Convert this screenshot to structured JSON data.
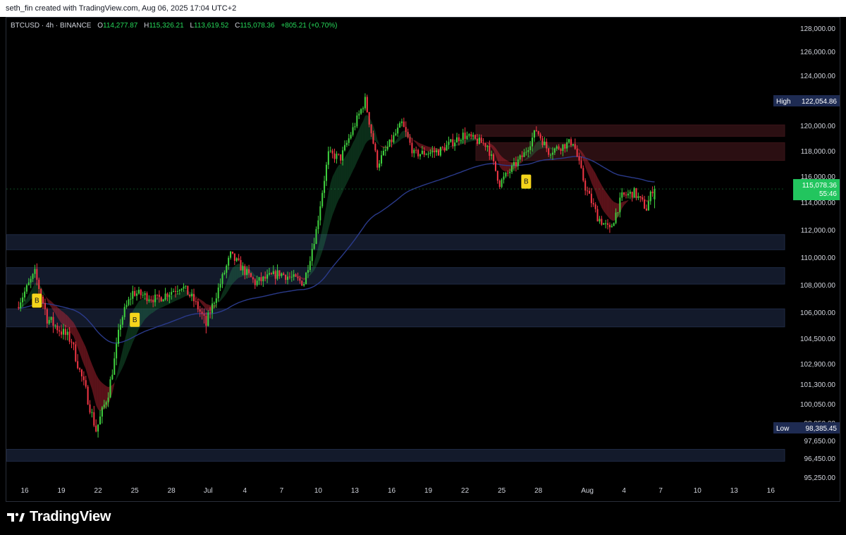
{
  "caption": "seth_fin created with TradingView.com, Aug 06, 2025 17:04 UTC+2",
  "legend": {
    "symbol": "BTCUSD · 4h · BINANCE",
    "open_label": "O",
    "open": "114,277.87",
    "high_label": "H",
    "high": "115,326.21",
    "low_label": "L",
    "low": "113,619.52",
    "close_label": "C",
    "close": "115,078.36",
    "change": "+805.21 (+0.70%)"
  },
  "brand": {
    "name": "TradingView"
  },
  "markers": {
    "buy_label": "B"
  },
  "chart_data": {
    "type": "candlestick",
    "symbol": "BTCUSD",
    "interval": "4h",
    "exchange": "BINANCE",
    "y_ticks": [
      "128,000.00",
      "126,000.00",
      "124,000.00",
      "122,000.00",
      "120,000.00",
      "118,000.00",
      "116,000.00",
      "114,000.00",
      "112,000.00",
      "110,000.00",
      "108,000.00",
      "106,000.00",
      "104,500.00",
      "102,900.00",
      "101,300.00",
      "100,050.00",
      "98,850.00",
      "97,650.00",
      "96,450.00",
      "95,250.00"
    ],
    "x_ticks": [
      "16",
      "19",
      "22",
      "25",
      "28",
      "Jul",
      "4",
      "7",
      "10",
      "13",
      "16",
      "19",
      "22",
      "25",
      "28",
      "Aug",
      "4",
      "7",
      "10",
      "13",
      "16"
    ],
    "high_marker": {
      "label": "High",
      "value": "122,054.86"
    },
    "low_marker": {
      "label": "Low",
      "value": "98,385.45"
    },
    "last_price": {
      "value": "115,078.36",
      "countdown": "55:46"
    },
    "scale": "log-like",
    "keypoints": [
      [
        "2025-06-15",
        105600
      ],
      [
        "2025-06-17",
        108900
      ],
      [
        "2025-06-18",
        105700
      ],
      [
        "2025-06-20",
        104400
      ],
      [
        "2025-06-22",
        98400
      ],
      [
        "2025-06-23",
        100800
      ],
      [
        "2025-06-24",
        105500
      ],
      [
        "2025-06-25",
        107500
      ],
      [
        "2025-06-27",
        107000
      ],
      [
        "2025-06-29",
        108000
      ],
      [
        "2025-06-30",
        106900
      ],
      [
        "2025-07-01",
        105300
      ],
      [
        "2025-07-03",
        110200
      ],
      [
        "2025-07-05",
        108200
      ],
      [
        "2025-07-07",
        108900
      ],
      [
        "2025-07-09",
        108200
      ],
      [
        "2025-07-10",
        112000
      ],
      [
        "2025-07-11",
        117800
      ],
      [
        "2025-07-12",
        117500
      ],
      [
        "2025-07-14",
        122054
      ],
      [
        "2025-07-15",
        117000
      ],
      [
        "2025-07-17",
        120200
      ],
      [
        "2025-07-18",
        117800
      ],
      [
        "2025-07-20",
        118000
      ],
      [
        "2025-07-22",
        119300
      ],
      [
        "2025-07-24",
        118500
      ],
      [
        "2025-07-25",
        115500
      ],
      [
        "2025-07-27",
        117800
      ],
      [
        "2025-07-28",
        119700
      ],
      [
        "2025-07-29",
        118000
      ],
      [
        "2025-07-31",
        118800
      ],
      [
        "2025-08-01",
        115200
      ],
      [
        "2025-08-02",
        113000
      ],
      [
        "2025-08-03",
        112000
      ],
      [
        "2025-08-04",
        114500
      ],
      [
        "2025-08-05",
        114800
      ],
      [
        "2025-08-06",
        113600
      ],
      [
        "2025-08-06T12",
        115078
      ]
    ],
    "buy_signals": [
      "2025-06-17",
      "2025-06-25",
      "2025-07-27"
    ],
    "zones": [
      {
        "kind": "resistance",
        "from": 119200,
        "to": 120100
      },
      {
        "kind": "resistance",
        "from": 117300,
        "to": 118700
      },
      {
        "kind": "support",
        "from": 110600,
        "to": 111700
      },
      {
        "kind": "support",
        "from": 108100,
        "to": 109300
      },
      {
        "kind": "support",
        "from": 105200,
        "to": 106300
      },
      {
        "kind": "support",
        "from": 96300,
        "to": 97100
      }
    ],
    "colors": {
      "up": "#26a69a",
      "up_bright": "#3fd13f",
      "down": "#f23645",
      "ma": "#2a3a8a",
      "support_zone": "#131a2b",
      "resistance_zone": "#2b0f12",
      "high_low_tag": "#1e2b52",
      "last_price_tag": "#22c55e",
      "signal": "#f5d51b"
    }
  }
}
